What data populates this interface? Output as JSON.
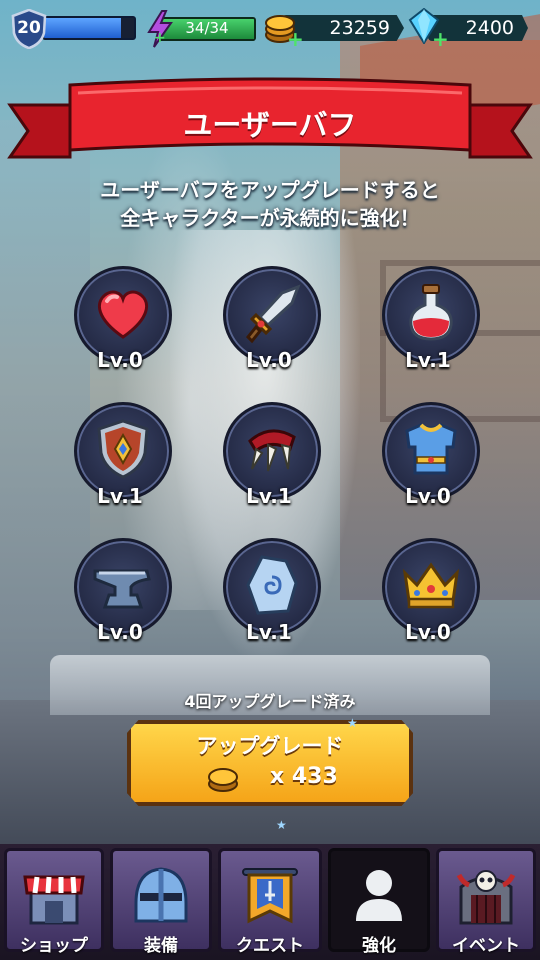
{
  "player": {
    "level": "20",
    "xp_fraction": 0.85,
    "energy": "34/34",
    "energy_fraction": 1.0,
    "coins": "23259",
    "gems": "2400"
  },
  "banner": {
    "title": "ユーザーバフ"
  },
  "description": {
    "line1": "ユーザーバフをアップグレードすると",
    "line2": "全キャラクターが永続的に強化！"
  },
  "buffs": [
    {
      "icon": "heart-icon",
      "level": "Lv.0"
    },
    {
      "icon": "sword-icon",
      "level": "Lv.0"
    },
    {
      "icon": "potion-icon",
      "level": "Lv.1"
    },
    {
      "icon": "shield-icon",
      "level": "Lv.1"
    },
    {
      "icon": "claw-icon",
      "level": "Lv.1"
    },
    {
      "icon": "armor-icon",
      "level": "Lv.0"
    },
    {
      "icon": "anvil-icon",
      "level": "Lv.0"
    },
    {
      "icon": "rune-stone-icon",
      "level": "Lv.1"
    },
    {
      "icon": "crown-icon",
      "level": "Lv.0"
    }
  ],
  "upgrade": {
    "count_text": "4回アップグレード済み",
    "label": "アップグレード",
    "cost": "x 433"
  },
  "nav": [
    {
      "label": "ショップ",
      "icon": "shop-icon"
    },
    {
      "label": "装備",
      "icon": "helmet-icon"
    },
    {
      "label": "クエスト",
      "icon": "quest-banner-icon"
    },
    {
      "label": "強化",
      "icon": "user-icon",
      "active": true
    },
    {
      "label": "イベント",
      "icon": "skull-gate-icon"
    }
  ],
  "colors": {
    "banner_red": "#e8242e",
    "button_gold": "#f5b52a",
    "xp_blue": "#2f7be6",
    "energy_green": "#2fb34e"
  }
}
